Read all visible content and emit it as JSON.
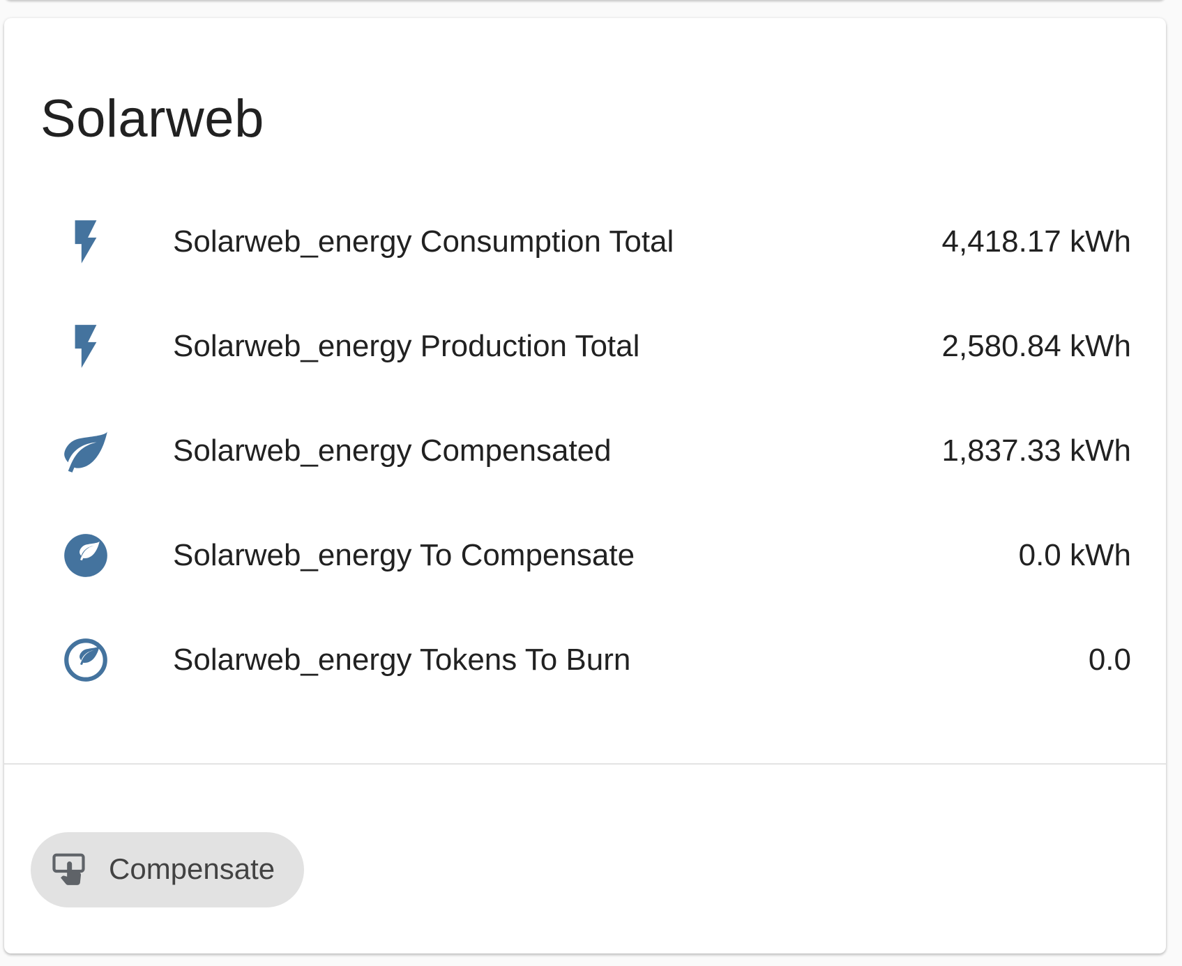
{
  "card": {
    "title": "Solarweb",
    "entities": [
      {
        "name": "Solarweb_energy Consumption Total",
        "state": "4,418.17 kWh",
        "icon": "flash-icon"
      },
      {
        "name": "Solarweb_energy Production Total",
        "state": "2,580.84 kWh",
        "icon": "flash-icon"
      },
      {
        "name": "Solarweb_energy Compensated",
        "state": "1,837.33 kWh",
        "icon": "leaf-icon"
      },
      {
        "name": "Solarweb_energy To Compensate",
        "state": "0.0 kWh",
        "icon": "leaf-circle-icon"
      },
      {
        "name": "Solarweb_energy Tokens To Burn",
        "state": "0.0",
        "icon": "leaf-circle-outline-icon"
      }
    ],
    "action": {
      "label": "Compensate",
      "icon": "gesture-tap-button-icon"
    }
  },
  "colors": {
    "icon": "#44739e",
    "text": "#212121",
    "button_bg": "#e2e2e2",
    "divider": "#e3e3e3"
  }
}
